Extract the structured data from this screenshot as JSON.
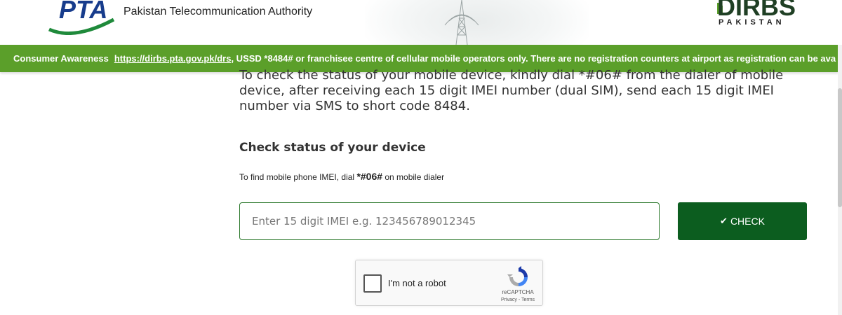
{
  "header": {
    "pta_logo_text": "PTA",
    "authority_name": "Pakistan Telecommunication Authority",
    "dirbs_logo_text": "DIRBS",
    "dirbs_sub": "PAKISTAN"
  },
  "banner": {
    "label": "Consumer Awareness",
    "link": "https://dirbs.pta.gov.pk/drs",
    "text": ", USSD *8484# or franchisee centre of cellular mobile operators only. There are no registration counters at airport as registration can be ava"
  },
  "main": {
    "intro": "To check the status of your mobile device, kindly dial *#06# from the dialer of mobile device, after receiving each 15 digit IMEI number (dual SIM), send each 15 digit IMEI number via SMS to short code 8484.",
    "section_title": "Check status of your device",
    "hint_prefix": "To find mobile phone IMEI, dial ",
    "hint_code": "*#06#",
    "hint_suffix": " on mobile dialer",
    "imei_placeholder": "Enter 15 digit IMEI e.g. 123456789012345",
    "imei_value": "",
    "check_label": "CHECK"
  },
  "captcha": {
    "label": "I'm not a robot",
    "brand": "reCAPTCHA",
    "terms": "Privacy - Terms"
  },
  "colors": {
    "banner_green": "#5b9f2a",
    "button_green": "#0c5d1f",
    "pta_green": "#1f8a3b",
    "pta_blue": "#173c8c"
  },
  "icons": {
    "check_button": "check-mark-icon",
    "captcha": "recaptcha-icon"
  }
}
